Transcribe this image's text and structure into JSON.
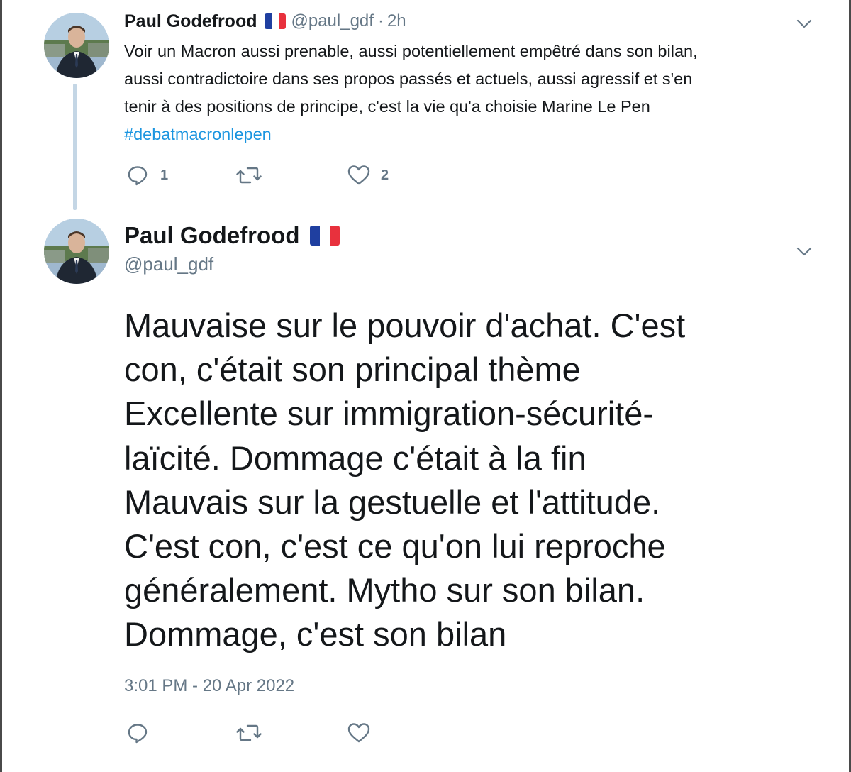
{
  "tweet1": {
    "name": "Paul Godefrood",
    "flag_icon": "france-flag-icon",
    "handle": "@paul_gdf",
    "separator": "·",
    "time": "2h",
    "text_lines": [
      "Voir un Macron aussi prenable, aussi potentiellement empêtré dans son bilan,",
      "aussi contradictoire dans ses propos passés et actuels, aussi agressif et s'en",
      "tenir à des positions de principe, c'est la vie qu'a choisie Marine Le Pen"
    ],
    "hashtag": "#debatmacronlepen",
    "reply_count": "1",
    "like_count": "2"
  },
  "tweet2": {
    "name": "Paul Godefrood",
    "flag_icon": "france-flag-icon",
    "handle": "@paul_gdf",
    "text_lines": [
      "Mauvaise sur le pouvoir d'achat. C'est",
      "con, c'était son principal thème",
      "Excellente sur immigration-sécurité-",
      "laïcité. Dommage c'était à la fin",
      "Mauvais sur la gestuelle et l'attitude.",
      "C'est con, c'est ce qu'on lui reproche",
      "généralement. Mytho sur son bilan.",
      "Dommage, c'est son bilan"
    ],
    "timestamp": "3:01 PM - 20 Apr 2022"
  },
  "colors": {
    "text": "#14171a",
    "secondary": "#657786",
    "link": "#1b95e0",
    "thread_line": "#c4d6e5",
    "flag_blue": "#1f3fa0",
    "flag_red": "#e8313d"
  }
}
